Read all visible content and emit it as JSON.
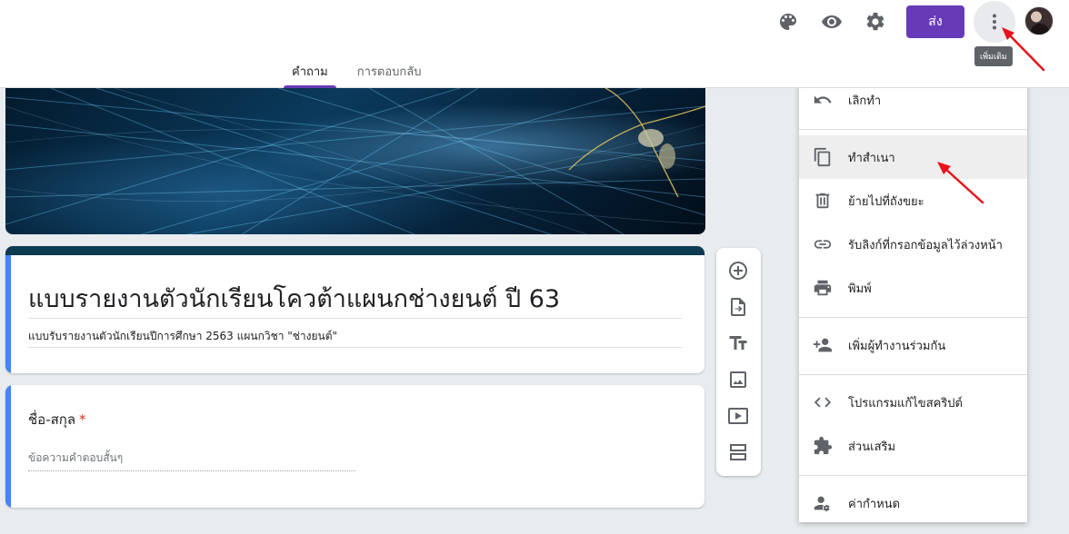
{
  "header": {
    "send_label": "ส่ง",
    "more_tooltip": "เพิ่มเติม",
    "icons": [
      "palette-icon",
      "eye-icon",
      "gear-icon",
      "more-vert-icon"
    ]
  },
  "tabs": [
    {
      "label": "คำถาม",
      "active": true
    },
    {
      "label": "การตอบกลับ",
      "active": false
    }
  ],
  "form": {
    "title": "แบบรายงานตัวนักเรียนโควต้าแผนกช่างยนต์ ปี 63",
    "description": "แบบรับรายงานตัวนักเรียนปีการศึกษา 2563 แผนกวิชา \"ช่างยนต์\""
  },
  "question": {
    "title": "ชื่อ-สกุล",
    "required_mark": "*",
    "answer_placeholder": "ข้อความคำตอบสั้นๆ"
  },
  "toolbar": {
    "items": [
      "add-question-icon",
      "import-questions-icon",
      "add-title-icon",
      "add-image-icon",
      "add-video-icon",
      "add-section-icon"
    ]
  },
  "menu": {
    "items": [
      {
        "label": "เลิกทำ",
        "icon": "undo-icon"
      },
      {
        "label": "ทำสำเนา",
        "icon": "copy-icon",
        "highlighted": true
      },
      {
        "label": "ย้ายไปที่ถังขยะ",
        "icon": "trash-icon"
      },
      {
        "label": "รับลิงก์ที่กรอกข้อมูลไว้ล่วงหน้า",
        "icon": "link-icon"
      },
      {
        "label": "พิมพ์",
        "icon": "print-icon"
      },
      {
        "label": "เพิ่มผู้ทำงานร่วมกัน",
        "icon": "add-person-icon"
      },
      {
        "label": "โปรแกรมแก้ไขสคริปต์",
        "icon": "code-icon"
      },
      {
        "label": "ส่วนเสริม",
        "icon": "puzzle-icon"
      },
      {
        "label": "ค่ากำหนด",
        "icon": "person-settings-icon"
      }
    ]
  },
  "colors": {
    "accent": "#673ab7",
    "title_strip": "#0d3b4f",
    "left_strip": "#4285f4",
    "required": "#d93025",
    "annotation": "#e8121b"
  }
}
